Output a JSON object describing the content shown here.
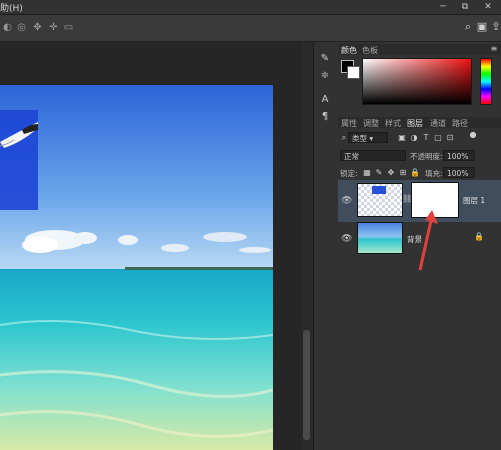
{
  "menubar": {
    "menu_fragment": "助(H)",
    "minimize": "─",
    "restore": "⧉",
    "close": "✕"
  },
  "optionsbar": {
    "icons": [
      "3d-rotate-icon",
      "3d-roll-icon",
      "3d-pan-icon",
      "3d-slide-icon",
      "3d-camera-icon"
    ],
    "search_glyph": "⌕"
  },
  "panels": {
    "color_tabs": [
      "颜色",
      "色板"
    ],
    "layer_tabs": [
      "属性",
      "调整",
      "样式",
      "图层",
      "通道",
      "路径"
    ],
    "filter_kind": "类型",
    "blend_mode": "正常",
    "opacity_label": "不透明度:",
    "opacity_value": "100%",
    "lock_label": "锁定:",
    "fill_label": "填充:",
    "fill_value": "100%",
    "layers": [
      {
        "name": "图层 1",
        "selected": true,
        "has_mask": true
      },
      {
        "name": "背景",
        "selected": false,
        "locked": true
      }
    ]
  },
  "colors": {
    "accent_arrow": "#e0413c",
    "selected_layer": "#3f4d5c",
    "fg_color": "#000000",
    "bg_color": "#ffffff"
  }
}
